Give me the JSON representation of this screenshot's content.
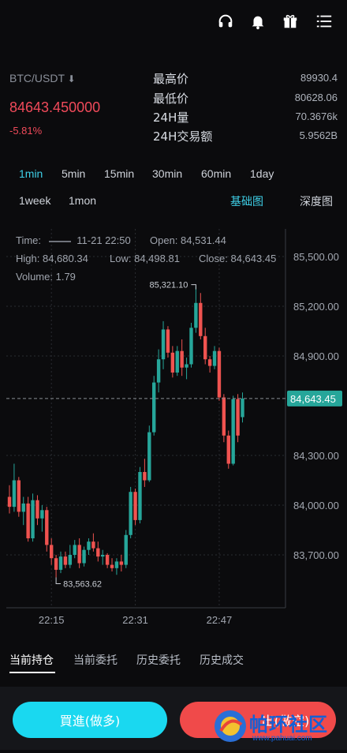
{
  "header": {
    "pair": "BTC/USDT",
    "pair_arrow": "⬇",
    "price": "84643.450000",
    "change": "-5.81%",
    "stats": [
      {
        "label": "最高价",
        "value": "89930.4"
      },
      {
        "label": "最低价",
        "value": "80628.06"
      },
      {
        "label": "24H量",
        "value": "70.3676k"
      },
      {
        "label": "24H交易额",
        "value": "5.9562B"
      }
    ]
  },
  "topbar": {
    "icons": [
      "headset-icon",
      "bell-icon",
      "gift-icon",
      "menu-icon"
    ]
  },
  "intervals": [
    "1min",
    "5min",
    "15min",
    "30min",
    "60min",
    "1day",
    "1week",
    "1mon"
  ],
  "active_interval": "1min",
  "chart_kinds": {
    "basic": "基础图",
    "depth": "深度图"
  },
  "info": {
    "time_label": "Time:",
    "time_value": "11-21 22:50",
    "open_label": "Open:",
    "open_value": "84,531.44",
    "high_label": "High:",
    "high_value": "84,680.34",
    "low_label": "Low:",
    "low_value": "84,498.81",
    "close_label": "Close:",
    "close_value": "84,643.45",
    "volume_label": "Volume:",
    "volume_value": "1.79"
  },
  "chart_data": {
    "type": "candlestick",
    "y_ticks": [
      "85,500.00",
      "85,200.00",
      "84,900.00",
      "84,300.00",
      "84,000.00",
      "83,700.00"
    ],
    "ylim": [
      83560,
      85540
    ],
    "x_ticks": [
      "22:15",
      "22:31",
      "22:47"
    ],
    "current_price_label": "84,643.45",
    "max_annotation": "85,321.10",
    "min_annotation": "83,563.62",
    "up_color": "#26a69a",
    "down_color": "#ef5350",
    "candles": [
      {
        "o": 84050,
        "h": 84120,
        "l": 83950,
        "c": 83990
      },
      {
        "o": 83990,
        "h": 84250,
        "l": 83960,
        "c": 84150
      },
      {
        "o": 84150,
        "h": 84170,
        "l": 83930,
        "c": 83960
      },
      {
        "o": 83960,
        "h": 84050,
        "l": 83880,
        "c": 84010
      },
      {
        "o": 84010,
        "h": 84050,
        "l": 83780,
        "c": 83800
      },
      {
        "o": 83800,
        "h": 84070,
        "l": 83780,
        "c": 84030
      },
      {
        "o": 84030,
        "h": 84060,
        "l": 83880,
        "c": 83920
      },
      {
        "o": 83920,
        "h": 84000,
        "l": 83840,
        "c": 83970
      },
      {
        "o": 83970,
        "h": 83990,
        "l": 83720,
        "c": 83760
      },
      {
        "o": 83760,
        "h": 83800,
        "l": 83640,
        "c": 83680
      },
      {
        "o": 83680,
        "h": 83700,
        "l": 83564,
        "c": 83610
      },
      {
        "o": 83610,
        "h": 83720,
        "l": 83590,
        "c": 83690
      },
      {
        "o": 83690,
        "h": 83720,
        "l": 83620,
        "c": 83640
      },
      {
        "o": 83640,
        "h": 83760,
        "l": 83620,
        "c": 83700
      },
      {
        "o": 83700,
        "h": 83790,
        "l": 83680,
        "c": 83760
      },
      {
        "o": 83760,
        "h": 83800,
        "l": 83620,
        "c": 83650
      },
      {
        "o": 83650,
        "h": 83750,
        "l": 83630,
        "c": 83730
      },
      {
        "o": 83730,
        "h": 83800,
        "l": 83700,
        "c": 83780
      },
      {
        "o": 83780,
        "h": 83830,
        "l": 83720,
        "c": 83740
      },
      {
        "o": 83740,
        "h": 83780,
        "l": 83660,
        "c": 83690
      },
      {
        "o": 83690,
        "h": 83730,
        "l": 83640,
        "c": 83700
      },
      {
        "o": 83700,
        "h": 83710,
        "l": 83620,
        "c": 83640
      },
      {
        "o": 83640,
        "h": 83680,
        "l": 83600,
        "c": 83620
      },
      {
        "o": 83620,
        "h": 83680,
        "l": 83580,
        "c": 83660
      },
      {
        "o": 83660,
        "h": 83700,
        "l": 83600,
        "c": 83640
      },
      {
        "o": 83640,
        "h": 83850,
        "l": 83620,
        "c": 83820
      },
      {
        "o": 83820,
        "h": 84110,
        "l": 83800,
        "c": 84080
      },
      {
        "o": 84080,
        "h": 84100,
        "l": 83880,
        "c": 83910
      },
      {
        "o": 83910,
        "h": 84230,
        "l": 83890,
        "c": 84200
      },
      {
        "o": 84200,
        "h": 84280,
        "l": 84110,
        "c": 84150
      },
      {
        "o": 84150,
        "h": 84480,
        "l": 84140,
        "c": 84440
      },
      {
        "o": 84440,
        "h": 84780,
        "l": 84420,
        "c": 84740
      },
      {
        "o": 84740,
        "h": 84940,
        "l": 84680,
        "c": 84880
      },
      {
        "o": 84880,
        "h": 85110,
        "l": 84820,
        "c": 85060
      },
      {
        "o": 85060,
        "h": 85080,
        "l": 84890,
        "c": 84920
      },
      {
        "o": 84920,
        "h": 84960,
        "l": 84770,
        "c": 84800
      },
      {
        "o": 84800,
        "h": 84960,
        "l": 84780,
        "c": 84930
      },
      {
        "o": 84930,
        "h": 85000,
        "l": 84780,
        "c": 84830
      },
      {
        "o": 84830,
        "h": 84890,
        "l": 84760,
        "c": 84850
      },
      {
        "o": 84850,
        "h": 85100,
        "l": 84830,
        "c": 85070
      },
      {
        "o": 85070,
        "h": 85321,
        "l": 85040,
        "c": 85220
      },
      {
        "o": 85220,
        "h": 85280,
        "l": 85000,
        "c": 85020
      },
      {
        "o": 85020,
        "h": 85070,
        "l": 84850,
        "c": 84880
      },
      {
        "o": 84880,
        "h": 84900,
        "l": 84800,
        "c": 84840
      },
      {
        "o": 84840,
        "h": 84960,
        "l": 84820,
        "c": 84930
      },
      {
        "o": 84930,
        "h": 84950,
        "l": 84630,
        "c": 84650
      },
      {
        "o": 84650,
        "h": 84670,
        "l": 84380,
        "c": 84420
      },
      {
        "o": 84420,
        "h": 84450,
        "l": 84220,
        "c": 84250
      },
      {
        "o": 84250,
        "h": 84660,
        "l": 84240,
        "c": 84640
      },
      {
        "o": 84640,
        "h": 84670,
        "l": 84380,
        "c": 84420
      },
      {
        "o": 84531,
        "h": 84680,
        "l": 84499,
        "c": 84643
      }
    ]
  },
  "position_tabs": [
    "当前持仓",
    "当前委托",
    "历史委托",
    "历史成交"
  ],
  "buttons": {
    "buy": "買進(做多)",
    "sell": "出(做空)"
  },
  "watermark": {
    "title": "帕环社区",
    "url": "www.pahuai.com"
  }
}
